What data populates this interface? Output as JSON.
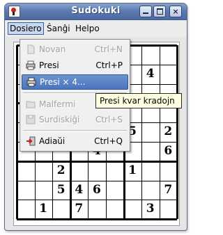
{
  "window": {
    "title": "Sudokuki",
    "buttons": {
      "minimize": "_",
      "maximize": "□",
      "close": "×"
    }
  },
  "menubar": {
    "items": [
      {
        "label": "Dosiero",
        "active": true
      },
      {
        "label": "Ŝanĝi",
        "active": false
      },
      {
        "label": "Helpo",
        "active": false
      }
    ]
  },
  "file_menu": {
    "items": [
      {
        "label": "Novan",
        "accel": "Ctrl+N",
        "enabled": false,
        "icon": "new-file-icon"
      },
      {
        "label": "Presi",
        "accel": "Ctrl+P",
        "enabled": true,
        "icon": "printer-icon"
      },
      {
        "label": "Presi × 4...",
        "accel": "",
        "enabled": true,
        "highlighted": true,
        "icon": "printer-icon"
      },
      {
        "label": "Malfermi",
        "accel": "",
        "enabled": false,
        "icon": "open-folder-icon"
      },
      {
        "label": "Surdiskiĝi",
        "accel": "Ctrl+S",
        "enabled": false,
        "icon": "save-disk-icon"
      },
      {
        "label": "Adiaŭi",
        "accel": "Ctrl+Q",
        "enabled": true,
        "icon": "exit-icon"
      }
    ]
  },
  "tooltip": {
    "text": "Presi kvar kradojn"
  },
  "grid": {
    "visible_digits": [
      {
        "row": 1,
        "col": 7,
        "value": "4"
      },
      {
        "row": 4,
        "col": 6,
        "value": "5"
      },
      {
        "row": 4,
        "col": 8,
        "value": "2"
      },
      {
        "row": 5,
        "col": 4,
        "value": "4"
      },
      {
        "row": 5,
        "col": 8,
        "value": "6"
      },
      {
        "row": 6,
        "col": 2,
        "value": "2"
      },
      {
        "row": 6,
        "col": 6,
        "value": "1"
      },
      {
        "row": 7,
        "col": 2,
        "value": "5"
      },
      {
        "row": 7,
        "col": 3,
        "value": "4"
      },
      {
        "row": 7,
        "col": 4,
        "value": "6"
      },
      {
        "row": 7,
        "col": 8,
        "value": "7"
      },
      {
        "row": 8,
        "col": 1,
        "value": "1"
      },
      {
        "row": 8,
        "col": 3,
        "value": "7"
      },
      {
        "row": 8,
        "col": 7,
        "value": "3"
      }
    ]
  }
}
